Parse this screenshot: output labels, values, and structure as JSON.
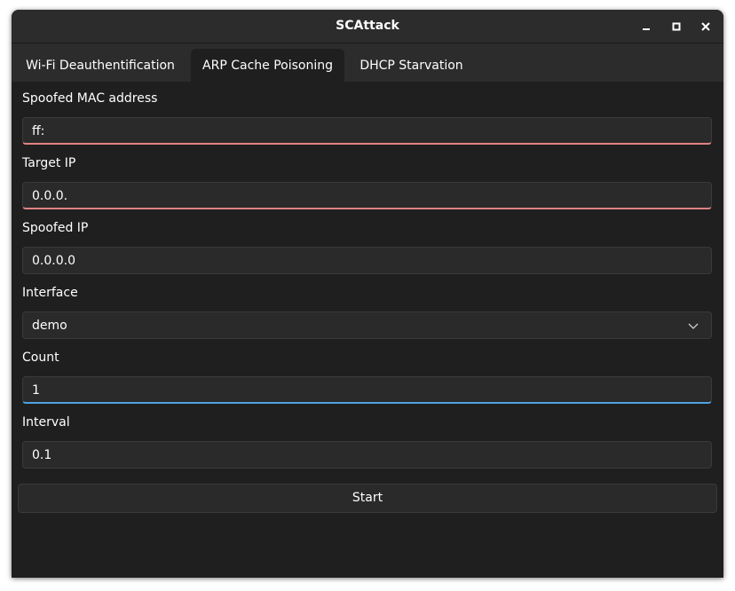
{
  "window": {
    "title": "SCAttack"
  },
  "tabs": [
    {
      "label": "Wi-Fi Deauthentification",
      "active": false
    },
    {
      "label": "ARP Cache Poisoning",
      "active": true
    },
    {
      "label": "DHCP Starvation",
      "active": false
    }
  ],
  "form": {
    "spoofed_mac": {
      "label": "Spoofed MAC address",
      "value": "ff:"
    },
    "target_ip": {
      "label": "Target IP",
      "value": "0.0.0."
    },
    "spoofed_ip": {
      "label": "Spoofed IP",
      "value": "0.0.0.0"
    },
    "interface": {
      "label": "Interface",
      "value": "demo"
    },
    "count": {
      "label": "Count",
      "value": "1"
    },
    "interval": {
      "label": "Interval",
      "value": "0.1"
    }
  },
  "start_label": "Start",
  "colors": {
    "error_underline": "#e08383",
    "focus_underline": "#4ea3e0",
    "background": "#1f1f1f",
    "header": "#2c2c2c"
  },
  "icons": {
    "minimize": "minimize-icon",
    "maximize": "maximize-icon",
    "close": "close-icon",
    "dropdown": "chevron-down-icon"
  }
}
